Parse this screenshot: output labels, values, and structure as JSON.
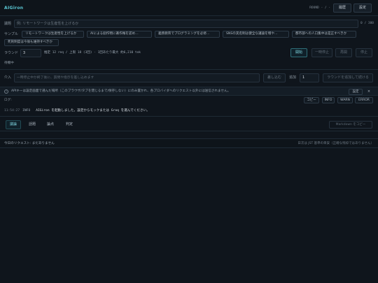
{
  "header": {
    "brand": "AIGiron",
    "round_label": "ROUND - / -",
    "history_label": "履歴",
    "settings_label": "設定"
  },
  "panel": {
    "topic_label": "議題",
    "topic_placeholder": "例: リモートワークは生産性を上げるか",
    "topic_count": "0 / 300",
    "samples_label": "サンプル",
    "samples": [
      "リモートワークは生産性を上げるか",
      "AIによる創作物に著作権を認め…",
      "義務教育でプログラミングを必修…",
      "SNSの実名制は健全な議論を増や…",
      "都市部への人口集中は是正すべきか",
      "死刑制度は今後も維持すべきか"
    ],
    "rounds_label": "ラウンド",
    "rounds_value": "3",
    "estimate": "推定 12 req / 上限 18 (3回) · 1回あたり最大 約6,210 tok",
    "start_label": "開始",
    "pause_label": "一時停止",
    "resume_label": "再開",
    "stop_label": "停止",
    "status": "待機中"
  },
  "intervene": {
    "label": "介入",
    "placeholder": "一時停止中か終了後に、質問や指示を差し込めます",
    "interject_label": "差し込む",
    "add_label": "追加",
    "add_value": "1",
    "add_rounds_label": "ラウンドを追加して続ける"
  },
  "notice": {
    "icon": "info-circle-icon",
    "text": "APIキーは設定画面で選んだ場所（このブラウザ/タブを閉じるまで/保存しない）にのみ置かれ、各プロバイダへのリクエスト以外には送信されません。",
    "settings_label": "設定",
    "close_label": "×"
  },
  "log": {
    "title": "ログ",
    "copy_label": "コピー",
    "info_label": "INFO",
    "warn_label": "WARN",
    "error_label": "ERROR",
    "entries": [
      {
        "time": "11:54:27",
        "level": "INFO",
        "message": "AIGiron を起動しました。設定からモックまたは Groq を選んでください。"
      }
    ]
  },
  "tabs": {
    "items": [
      "議論",
      "話題",
      "論点",
      "判定"
    ],
    "active": "議論",
    "markdown_label": "Markdown をコピー"
  },
  "footer": {
    "left": "今日のリクエスト: まだありません",
    "right": "日次は JST 基準の目安（正確な残枠ではありません）"
  },
  "colors": {
    "background": "#0f151c",
    "accent": "#5bc8d4"
  }
}
